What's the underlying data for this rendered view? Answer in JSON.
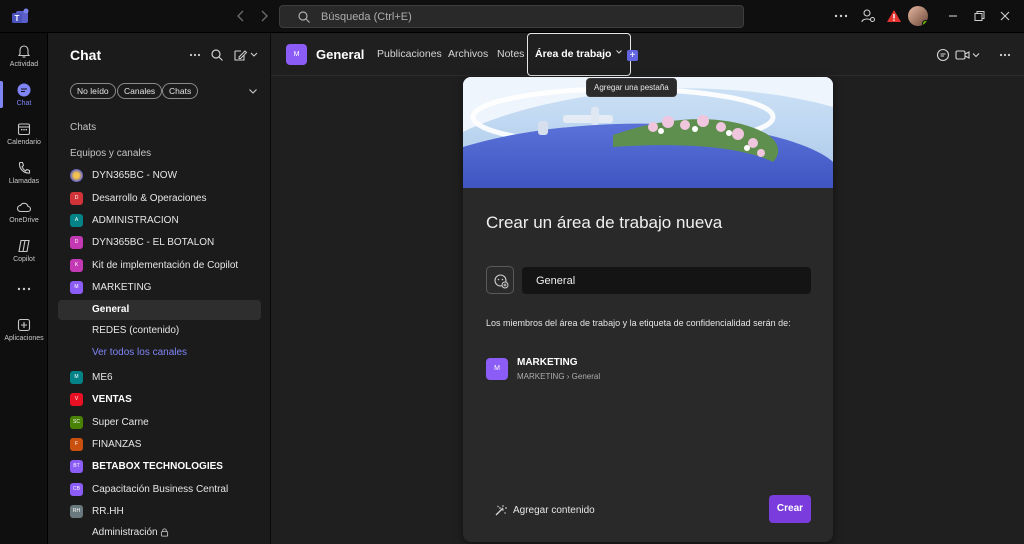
{
  "titlebar": {
    "search_placeholder": "Búsqueda (Ctrl+E)"
  },
  "rail": {
    "items": [
      {
        "label": "Actividad",
        "icon": "bell-icon"
      },
      {
        "label": "Chat",
        "icon": "chat-icon"
      },
      {
        "label": "Calendario",
        "icon": "calendar-icon"
      },
      {
        "label": "Llamadas",
        "icon": "phone-icon"
      },
      {
        "label": "OneDrive",
        "icon": "cloud-icon"
      },
      {
        "label": "Copilot",
        "icon": "copilot-icon"
      },
      {
        "label": "Aplicaciones",
        "icon": "plus-square-icon"
      }
    ],
    "active": "Chat",
    "accent": "#7f85f5"
  },
  "left": {
    "title": "Chat",
    "filters": [
      "No leído",
      "Canales",
      "Chats"
    ],
    "section_chats": "Chats",
    "section_teams": "Equipos y canales",
    "teams": [
      {
        "label": "DYN365BC - NOW",
        "initials": "",
        "color": "#5b5fc7",
        "bold": false
      },
      {
        "label": "Desarrollo & Operaciones",
        "initials": "D",
        "color": "#d13438",
        "bold": false
      },
      {
        "label": "ADMINISTRACION",
        "initials": "A",
        "color": "#038387",
        "bold": false
      },
      {
        "label": "DYN365BC - EL BOTALON",
        "initials": "D",
        "color": "#c239b3",
        "bold": false
      },
      {
        "label": "Kit de implementación de Copilot",
        "initials": "K",
        "color": "#c239b3",
        "bold": false
      },
      {
        "label": "MARKETING",
        "initials": "M",
        "color": "#8b5cf6",
        "bold": false
      }
    ],
    "channels": [
      {
        "label": "General",
        "selected": true
      },
      {
        "label": "REDES (contenido)",
        "selected": false
      }
    ],
    "see_all": "Ver todos los canales",
    "teams_more": [
      {
        "label": "ME6",
        "initials": "M",
        "color": "#038387",
        "bold": false
      },
      {
        "label": "VENTAS",
        "initials": "V",
        "color": "#e81123",
        "bold": true
      },
      {
        "label": "Super Carne",
        "initials": "SC",
        "color": "#498205",
        "bold": false
      },
      {
        "label": "FINANZAS",
        "initials": "F",
        "color": "#ca5010",
        "bold": false
      },
      {
        "label": "BETABOX TECHNOLOGIES",
        "initials": "BT",
        "color": "#8b5cf6",
        "bold": true
      },
      {
        "label": "Capacitación Business Central",
        "initials": "CB",
        "color": "#8b5cf6",
        "bold": false
      },
      {
        "label": "RR.HH",
        "initials": "RH",
        "color": "#69797e",
        "bold": false
      }
    ],
    "last_channel": "Administración"
  },
  "channel_header": {
    "avatar": "M",
    "name": "General",
    "tabs": [
      "Publicaciones",
      "Archivos",
      "Notes"
    ],
    "active_tab": "Área de trabajo",
    "tooltip": "Agregar una pestaña"
  },
  "workspace_card": {
    "title": "Crear un área de trabajo nueva",
    "name_value": "General",
    "description": "Los miembros del área de trabajo y la etiqueta de confidencialidad serán de:",
    "team_avatar": "M",
    "team_name": "MARKETING",
    "team_path": "MARKETING  ›  General",
    "add_content": "Agregar contenido",
    "create": "Crear",
    "create_color": "#7a3cdc"
  }
}
